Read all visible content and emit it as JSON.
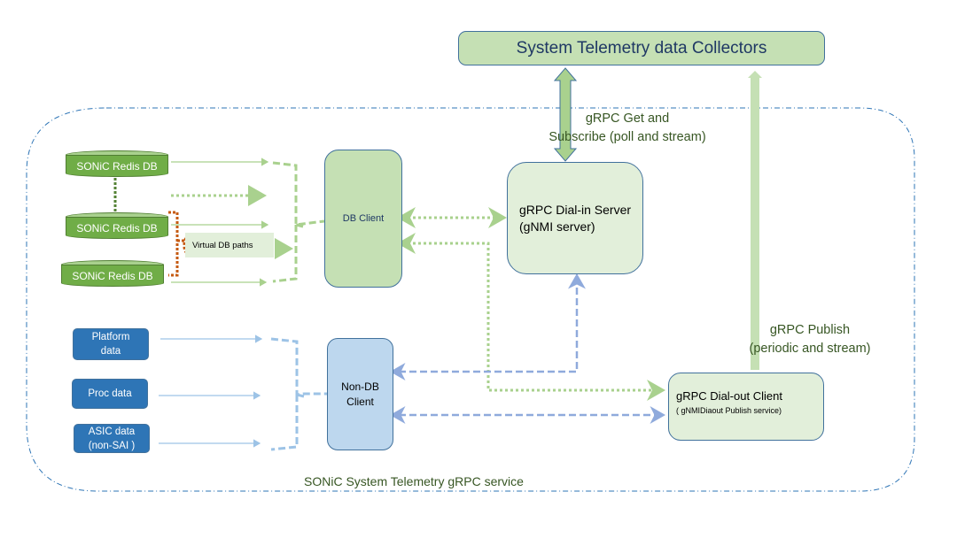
{
  "title": "SONiC System Telemetry gRPC service",
  "collectors": {
    "label": "System Telemetry data Collectors"
  },
  "redis_dbs": [
    {
      "label": "SONiC Redis DB"
    },
    {
      "label": "SONiC Redis DB"
    },
    {
      "label": "SONiC Redis DB"
    }
  ],
  "virtual_db": {
    "label": "Virtual DB paths"
  },
  "db_client": {
    "label": "DB Client"
  },
  "non_db_client": {
    "line1": "Non-DB",
    "line2": "Client"
  },
  "dial_in_server": {
    "line1": "gRPC Dial-in Server",
    "line2": "(gNMI server)"
  },
  "dial_out_client": {
    "line1": "gRPC Dial-out Client",
    "line2": "( gNMIDiaout Publish service)"
  },
  "sources": [
    {
      "line1": "Platform",
      "line2": "data"
    },
    {
      "line1": "Proc data",
      "line2": ""
    },
    {
      "line1": "ASIC data",
      "line2": "(non-SAI )"
    }
  ],
  "get_subscribe": {
    "line1": "gRPC Get  and",
    "line2": "Subscribe (poll and stream)"
  },
  "publish": {
    "line1": "gRPC Publish",
    "line2": "(periodic and stream)"
  },
  "colors": {
    "green_fill": "#c5e0b4",
    "light_green_fill": "#e2efda",
    "blue_fill": "#2e75b6",
    "light_blue_fill": "#bdd7ee",
    "border": "#41719c",
    "redis_green": "#70ad47",
    "orange_dotted": "#c55a11",
    "text_green": "#375623"
  }
}
